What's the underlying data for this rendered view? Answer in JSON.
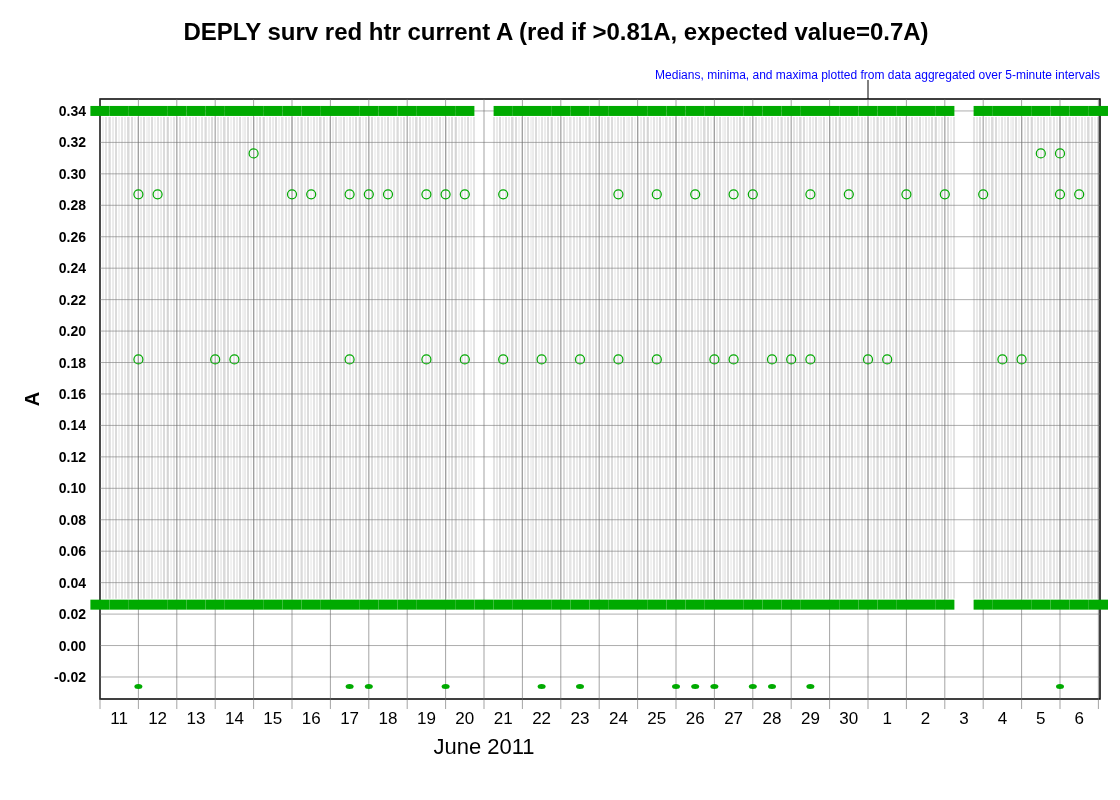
{
  "chart_data": {
    "type": "scatter",
    "title": "DEPLY surv red htr current A (red if >0.81A, expected value=0.7A)",
    "subtitle": "Medians, minima, and maxima plotted from data aggregated over 5-minute intervals",
    "xlabel": "June 2011",
    "ylabel": "A",
    "x": [
      "2011-06-11 00:00",
      "2011-06-11 12:00",
      "2011-06-12 00:00",
      "2011-06-12 12:00",
      "2011-06-13 00:00",
      "2011-06-13 12:00",
      "2011-06-14 00:00",
      "2011-06-14 12:00",
      "2011-06-15 00:00",
      "2011-06-15 12:00",
      "2011-06-16 00:00",
      "2011-06-16 12:00",
      "2011-06-17 00:00",
      "2011-06-17 12:00",
      "2011-06-18 00:00",
      "2011-06-18 12:00",
      "2011-06-19 00:00",
      "2011-06-19 12:00",
      "2011-06-20 00:00",
      "2011-06-20 12:00",
      "2011-06-21 00:00",
      "2011-06-21 12:00",
      "2011-06-22 00:00",
      "2011-06-22 12:00",
      "2011-06-23 00:00",
      "2011-06-23 12:00",
      "2011-06-24 00:00",
      "2011-06-24 12:00",
      "2011-06-25 00:00",
      "2011-06-25 12:00",
      "2011-06-26 00:00",
      "2011-06-26 12:00",
      "2011-06-27 00:00",
      "2011-06-27 12:00",
      "2011-06-28 00:00",
      "2011-06-28 12:00",
      "2011-06-29 00:00",
      "2011-06-29 12:00",
      "2011-06-30 00:00",
      "2011-06-30 12:00",
      "2011-07-01 00:00",
      "2011-07-01 12:00",
      "2011-07-02 00:00",
      "2011-07-02 12:00",
      "2011-07-03 00:00",
      "2011-07-04 00:00",
      "2011-07-04 12:00",
      "2011-07-05 00:00",
      "2011-07-05 12:00",
      "2011-07-06 00:00",
      "2011-07-06 12:00",
      "2011-07-07 00:00"
    ],
    "series": [
      {
        "color": "#00aa00",
        "values": [
          0.34,
          0.34,
          0.34,
          0.34,
          0.34,
          0.34,
          0.34,
          0.34,
          0.34,
          0.34,
          0.34,
          0.34,
          0.34,
          0.34,
          0.34,
          0.34,
          0.34,
          0.34,
          0.34,
          0.34,
          null,
          0.34,
          0.34,
          0.34,
          0.34,
          0.34,
          0.34,
          0.34,
          0.34,
          0.34,
          0.34,
          0.34,
          0.34,
          0.34,
          0.34,
          0.34,
          0.34,
          0.34,
          0.34,
          0.34,
          0.34,
          0.34,
          0.34,
          0.34,
          0.34,
          0.34,
          0.34,
          0.34,
          0.34,
          0.34,
          0.34,
          0.34
        ]
      },
      {
        "color": "#00aa00",
        "values": [
          0.026,
          0.026,
          0.026,
          0.026,
          0.026,
          0.026,
          0.026,
          0.026,
          0.026,
          0.026,
          0.026,
          0.026,
          0.026,
          0.026,
          0.026,
          0.026,
          0.026,
          0.026,
          0.026,
          0.026,
          0.026,
          0.026,
          0.026,
          0.026,
          0.026,
          0.026,
          0.026,
          0.026,
          0.026,
          0.026,
          0.026,
          0.026,
          0.026,
          0.026,
          0.026,
          0.026,
          0.026,
          0.026,
          0.026,
          0.026,
          0.026,
          0.026,
          0.026,
          0.026,
          0.026,
          0.026,
          0.026,
          0.026,
          0.026,
          0.026,
          0.026,
          0.026
        ]
      },
      {
        "color": "#00aa00",
        "values": [
          null,
          null,
          0.287,
          0.287,
          null,
          null,
          null,
          null,
          null,
          null,
          0.287,
          0.287,
          null,
          0.287,
          0.287,
          0.287,
          null,
          0.287,
          0.287,
          0.287,
          null,
          0.287,
          null,
          null,
          null,
          null,
          null,
          0.287,
          null,
          0.287,
          null,
          0.287,
          null,
          0.287,
          0.287,
          null,
          null,
          0.287,
          null,
          0.287,
          null,
          null,
          0.287,
          null,
          0.287,
          0.287,
          null,
          null,
          null,
          0.287,
          0.287,
          null
        ]
      },
      {
        "color": "#00aa00",
        "values": [
          null,
          null,
          null,
          null,
          null,
          null,
          null,
          null,
          0.313,
          null,
          null,
          null,
          null,
          null,
          null,
          null,
          null,
          null,
          null,
          null,
          null,
          null,
          null,
          null,
          null,
          null,
          null,
          null,
          null,
          null,
          null,
          null,
          null,
          null,
          null,
          null,
          null,
          null,
          null,
          null,
          null,
          null,
          null,
          null,
          null,
          null,
          null,
          null,
          0.313,
          0.313,
          null,
          null
        ]
      },
      {
        "color": "#00aa00",
        "values": [
          null,
          null,
          0.182,
          null,
          null,
          null,
          0.182,
          0.182,
          null,
          null,
          null,
          null,
          null,
          0.182,
          null,
          null,
          null,
          0.182,
          null,
          0.182,
          null,
          0.182,
          null,
          0.182,
          null,
          0.182,
          null,
          0.182,
          null,
          0.182,
          null,
          null,
          0.182,
          0.182,
          null,
          0.182,
          0.182,
          0.182,
          null,
          null,
          0.182,
          0.182,
          null,
          null,
          null,
          null,
          0.182,
          0.182,
          null,
          null,
          null,
          null
        ]
      },
      {
        "color": "#00aa00",
        "values": [
          null,
          null,
          -0.026,
          null,
          null,
          null,
          null,
          null,
          null,
          null,
          null,
          null,
          null,
          -0.026,
          -0.026,
          null,
          null,
          null,
          -0.026,
          null,
          null,
          null,
          null,
          -0.026,
          null,
          -0.026,
          null,
          null,
          null,
          null,
          -0.026,
          -0.026,
          -0.026,
          null,
          -0.026,
          -0.026,
          null,
          -0.026,
          null,
          null,
          null,
          null,
          null,
          null,
          null,
          null,
          null,
          null,
          null,
          -0.026,
          null,
          null
        ]
      }
    ],
    "grid": true,
    "xlim": [
      "2011-06-11 00:00",
      "2011-07-07 01:00"
    ],
    "ylim": [
      -0.034,
      0.3476
    ],
    "xticks": [
      {
        "value": "2011-06-11 12:00",
        "label": "11"
      },
      {
        "value": "2011-06-12 12:00",
        "label": "12"
      },
      {
        "value": "2011-06-13 12:00",
        "label": "13"
      },
      {
        "value": "2011-06-14 12:00",
        "label": "14"
      },
      {
        "value": "2011-06-15 12:00",
        "label": "15"
      },
      {
        "value": "2011-06-16 12:00",
        "label": "16"
      },
      {
        "value": "2011-06-17 12:00",
        "label": "17"
      },
      {
        "value": "2011-06-18 12:00",
        "label": "18"
      },
      {
        "value": "2011-06-19 12:00",
        "label": "19"
      },
      {
        "value": "2011-06-20 12:00",
        "label": "20"
      },
      {
        "value": "2011-06-21 12:00",
        "label": "21"
      },
      {
        "value": "2011-06-22 12:00",
        "label": "22"
      },
      {
        "value": "2011-06-23 12:00",
        "label": "23"
      },
      {
        "value": "2011-06-24 12:00",
        "label": "24"
      },
      {
        "value": "2011-06-25 12:00",
        "label": "25"
      },
      {
        "value": "2011-06-26 12:00",
        "label": "26"
      },
      {
        "value": "2011-06-27 12:00",
        "label": "27"
      },
      {
        "value": "2011-06-28 12:00",
        "label": "28"
      },
      {
        "value": "2011-06-29 12:00",
        "label": "29"
      },
      {
        "value": "2011-06-30 12:00",
        "label": "30"
      },
      {
        "value": "2011-07-01 12:00",
        "label": "1"
      },
      {
        "value": "2011-07-02 12:00",
        "label": "2"
      },
      {
        "value": "2011-07-03 12:00",
        "label": "3"
      },
      {
        "value": "2011-07-04 12:00",
        "label": "4"
      },
      {
        "value": "2011-07-05 12:00",
        "label": "5"
      },
      {
        "value": "2011-07-06 12:00",
        "label": "6"
      }
    ],
    "yticks": [
      {
        "value": -0.02,
        "label": "-0.02"
      },
      {
        "value": 0,
        "label": "0.00"
      },
      {
        "value": 0.02,
        "label": "0.02"
      },
      {
        "value": 0.04,
        "label": "0.04"
      },
      {
        "value": 0.06,
        "label": "0.06"
      },
      {
        "value": 0.08,
        "label": "0.08"
      },
      {
        "value": 0.1,
        "label": "0.10"
      },
      {
        "value": 0.12,
        "label": "0.12"
      },
      {
        "value": 0.14,
        "label": "0.14"
      },
      {
        "value": 0.16,
        "label": "0.16"
      },
      {
        "value": 0.18,
        "label": "0.18"
      },
      {
        "value": 0.2,
        "label": "0.20"
      },
      {
        "value": 0.22,
        "label": "0.22"
      },
      {
        "value": 0.24,
        "label": "0.24"
      },
      {
        "value": 0.26,
        "label": "0.26"
      },
      {
        "value": 0.28,
        "label": "0.28"
      },
      {
        "value": 0.3,
        "label": "0.30"
      },
      {
        "value": 0.32,
        "label": "0.32"
      },
      {
        "value": 0.34,
        "label": "0.34"
      }
    ]
  }
}
